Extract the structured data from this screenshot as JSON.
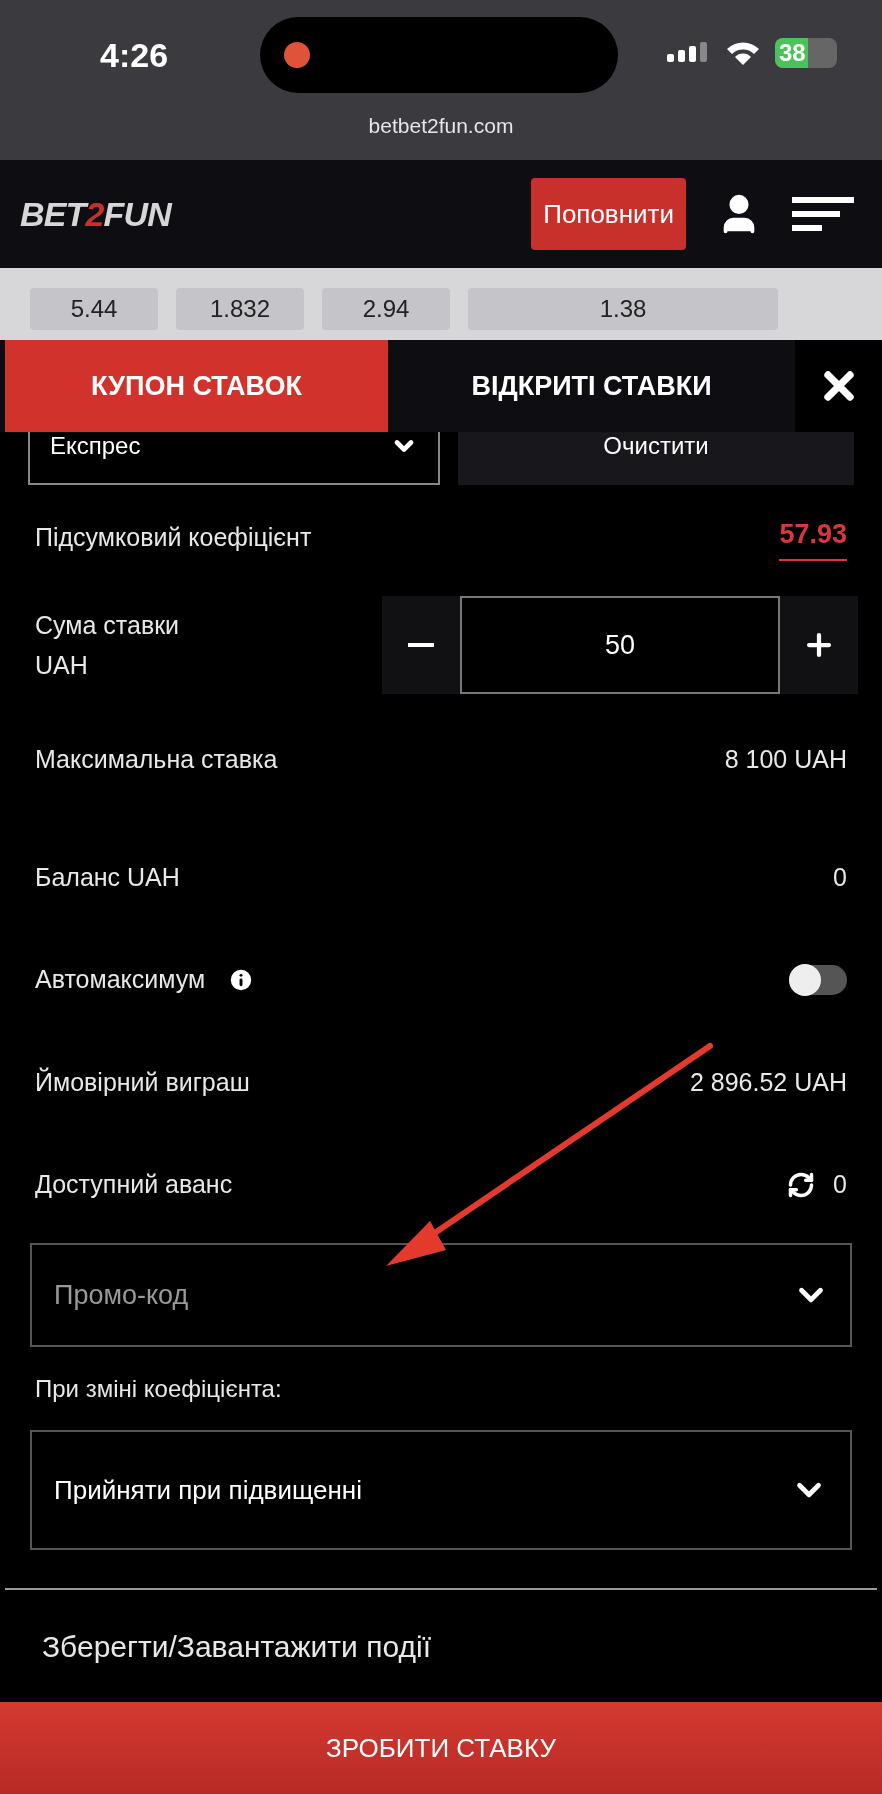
{
  "status_bar": {
    "time": "4:26",
    "battery": "38"
  },
  "browser": {
    "url": "betbet2fun.com"
  },
  "header": {
    "logo": [
      {
        "text": "BET",
        "accent": false
      },
      {
        "text": "2",
        "accent": true
      },
      {
        "text": "FUN",
        "accent": false
      }
    ],
    "deposit_button": "Поповнити"
  },
  "odds": [
    "5.44",
    "1.832",
    "2.94",
    "1.38"
  ],
  "tabs": [
    {
      "label": "КУПОН СТАВОК",
      "selected": true
    },
    {
      "label": "ВІДКРИТІ СТАВКИ",
      "selected": false
    }
  ],
  "bet_type": {
    "value": "Експрес"
  },
  "clear_button": "Очистити",
  "rows": [
    {
      "kind": "coefficient",
      "label": "Підсумковий коефіцієнт",
      "value": "57.93"
    },
    {
      "kind": "stake",
      "label": "Сума ставки",
      "sublabel": "UAH",
      "value": "50"
    },
    {
      "kind": "value",
      "label": "Максимальна ставка",
      "value": "8 100 UAH"
    },
    {
      "kind": "value",
      "label": "Баланс UAH",
      "value": "0"
    },
    {
      "kind": "toggle",
      "label": "Автомаксимум",
      "on": false
    },
    {
      "kind": "value",
      "label": "Ймовірний виграш",
      "value": "2 896.52 UAH"
    },
    {
      "kind": "refresh",
      "label": "Доступний аванс",
      "value": "0"
    }
  ],
  "promo_code": {
    "placeholder": "Промо-код"
  },
  "odds_change": {
    "label": "При зміні коефіцієнта:",
    "value": "Прийняти при підвищенні"
  },
  "save_load": "Зберегти/Завантажити події",
  "place_bet": "ЗРОБИТИ СТАВКУ"
}
